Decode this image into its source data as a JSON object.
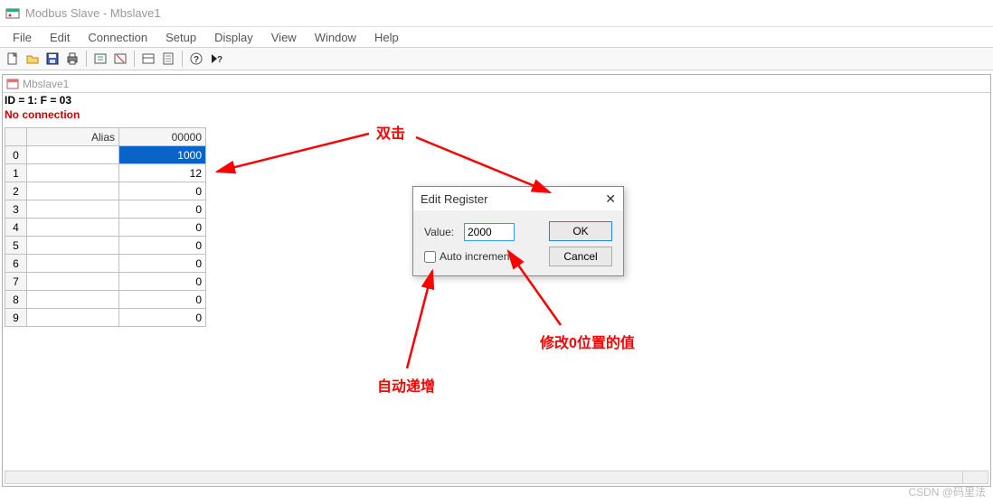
{
  "app": {
    "title": "Modbus Slave - Mbslave1"
  },
  "menu": [
    "File",
    "Edit",
    "Connection",
    "Setup",
    "Display",
    "View",
    "Window",
    "Help"
  ],
  "toolbar_icons": [
    "new",
    "open",
    "save",
    "print",
    "connect",
    "disconnect",
    "setup",
    "display",
    "help",
    "context-help"
  ],
  "document": {
    "title": "Mbslave1",
    "status": "ID = 1: F = 03",
    "connection": "No connection"
  },
  "table": {
    "headers": {
      "alias": "Alias",
      "value": "00000"
    },
    "rows": [
      {
        "alias": "",
        "value": "1000",
        "selected": true
      },
      {
        "alias": "",
        "value": "12"
      },
      {
        "alias": "",
        "value": "0"
      },
      {
        "alias": "",
        "value": "0"
      },
      {
        "alias": "",
        "value": "0"
      },
      {
        "alias": "",
        "value": "0"
      },
      {
        "alias": "",
        "value": "0"
      },
      {
        "alias": "",
        "value": "0"
      },
      {
        "alias": "",
        "value": "0"
      },
      {
        "alias": "",
        "value": "0"
      }
    ]
  },
  "dialog": {
    "title": "Edit Register",
    "value_label": "Value:",
    "value": "2000",
    "auto_increment_label": "Auto increment",
    "auto_increment": false,
    "ok": "OK",
    "cancel": "Cancel"
  },
  "annotations": {
    "dblclick": "双击",
    "modify": "修改0位置的值",
    "autoinc": "自动递增"
  },
  "watermark": "CSDN @码里法"
}
